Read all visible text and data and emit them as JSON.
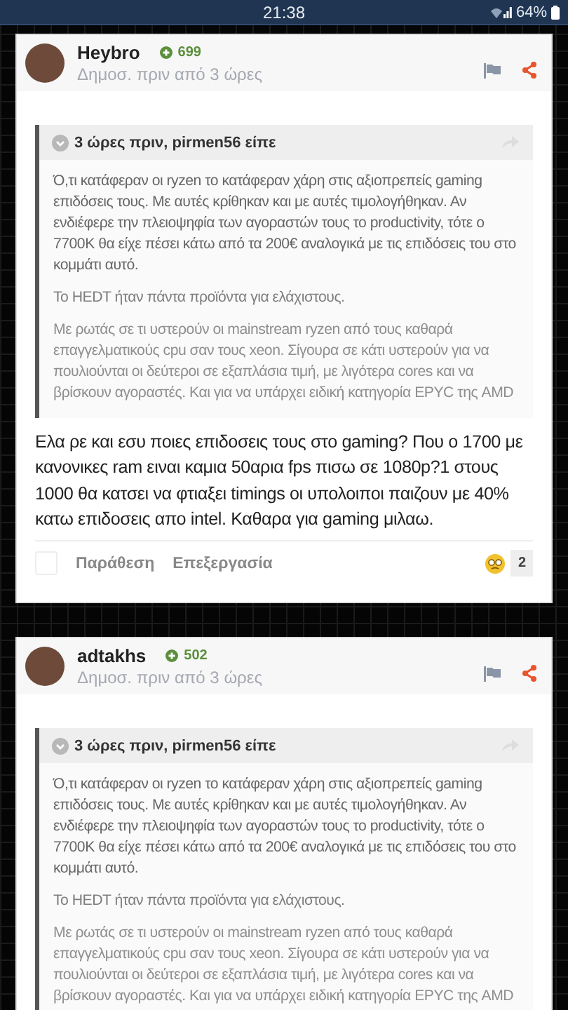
{
  "status_bar": {
    "time": "21:38",
    "battery": "64%"
  },
  "posts": [
    {
      "author": "Heybro",
      "reputation": "699",
      "meta": "Δημοσ. πριν από 3 ώρες",
      "quote": {
        "header": "3 ώρες πριν, pirmen56 είπε",
        "paragraphs": [
          "Ό,τι κατάφεραν οι ryzen το κατάφεραν χάρη στις αξιοπρεπείς gaming επιδόσεις τους. Με αυτές κρίθηκαν και με αυτές τιμολογήθηκαν. Αν ενδιέφερε την πλειοψηφία των αγοραστών τους το productivity, τότε ο 7700K θα είχε πέσει κάτω από τα 200€ αναλογικά με τις επιδόσεις του στο κομμάτι αυτό.",
          "Το HEDT ήταν πάντα προϊόντα για ελάχιστους.",
          "Με ρωτάς σε τι υστερούν οι mainstream ryzen από τους καθαρά επαγγελματικούς cpu σαν τους xeon. Σίγουρα σε κάτι υστερούν για να πουλιούνται οι δεύτεροι σε εξαπλάσια τιμή, με λιγότερα cores και να βρίσκουν αγοραστές. Και για να υπάρχει ειδική κατηγορία EPYC της AMD"
        ]
      },
      "body": "Ελα ρε και εσυ ποιες επιδοσεις τους στο gaming? Που ο 1700 με κανονικες ram ειναι καμια 50αρια fps πισω σε 1080p?1 στους 1000 θα κατσει να φτιαξει timings οι υπολοιποι παιζουν με 40% κατω επιδοσεις απο intel. Καθαρα για gaming μιλαω.",
      "footer": {
        "checked": false,
        "actions": [
          "Παράθεση",
          "Επεξεργασία"
        ],
        "reaction_count": "2"
      }
    },
    {
      "author": "adtakhs",
      "reputation": "502",
      "meta": "Δημοσ. πριν από 3 ώρες",
      "quote": {
        "header": "3 ώρες πριν, pirmen56 είπε",
        "paragraphs": [
          "Ό,τι κατάφεραν οι ryzen το κατάφεραν χάρη στις αξιοπρεπείς gaming επιδόσεις τους. Με αυτές κρίθηκαν και με αυτές τιμολογήθηκαν. Αν ενδιέφερε την πλειοψηφία των αγοραστών τους το productivity, τότε ο 7700K θα είχε πέσει κάτω από τα 200€ αναλογικά με τις επιδόσεις του στο κομμάτι αυτό.",
          "Το HEDT ήταν πάντα προϊόντα για ελάχιστους.",
          "Με ρωτάς σε τι υστερούν οι mainstream ryzen από τους καθαρά επαγγελματικούς cpu σαν τους xeon. Σίγουρα σε κάτι υστερούν για να πουλιούνται οι δεύτεροι σε εξαπλάσια τιμή, με λιγότερα cores και να βρίσκουν αγοραστές. Και για να υπάρχει ειδική κατηγορία EPYC της AMD"
        ]
      }
    }
  ]
}
